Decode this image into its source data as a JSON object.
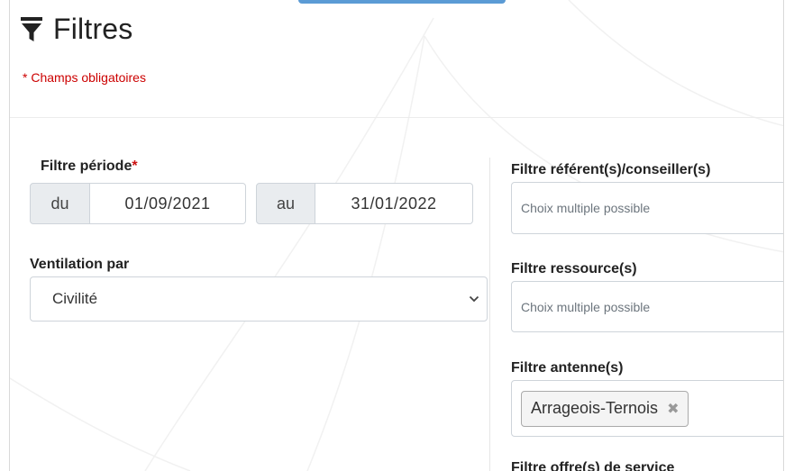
{
  "header": {
    "title": "Filtres",
    "required_note": "* Champs obligatoires"
  },
  "periode": {
    "label": "Filtre période",
    "required_mark": "*",
    "from_prefix": "du",
    "from_value": "01/09/2021",
    "to_prefix": "au",
    "to_value": "31/01/2022"
  },
  "ventilation": {
    "label": "Ventilation par",
    "selected": "Civilité"
  },
  "referents": {
    "label": "Filtre référent(s)/conseiller(s)",
    "placeholder": "Choix multiple possible"
  },
  "ressources": {
    "label": "Filtre ressource(s)",
    "placeholder": "Choix multiple possible"
  },
  "antennes": {
    "label": "Filtre antenne(s)",
    "chips": [
      {
        "label": "Arrageois-Ternois",
        "remove": "✖"
      }
    ]
  },
  "offres": {
    "label": "Filtre offre(s) de service"
  },
  "colors": {
    "required": "#cc0000",
    "accent": "#5b9bd5"
  }
}
